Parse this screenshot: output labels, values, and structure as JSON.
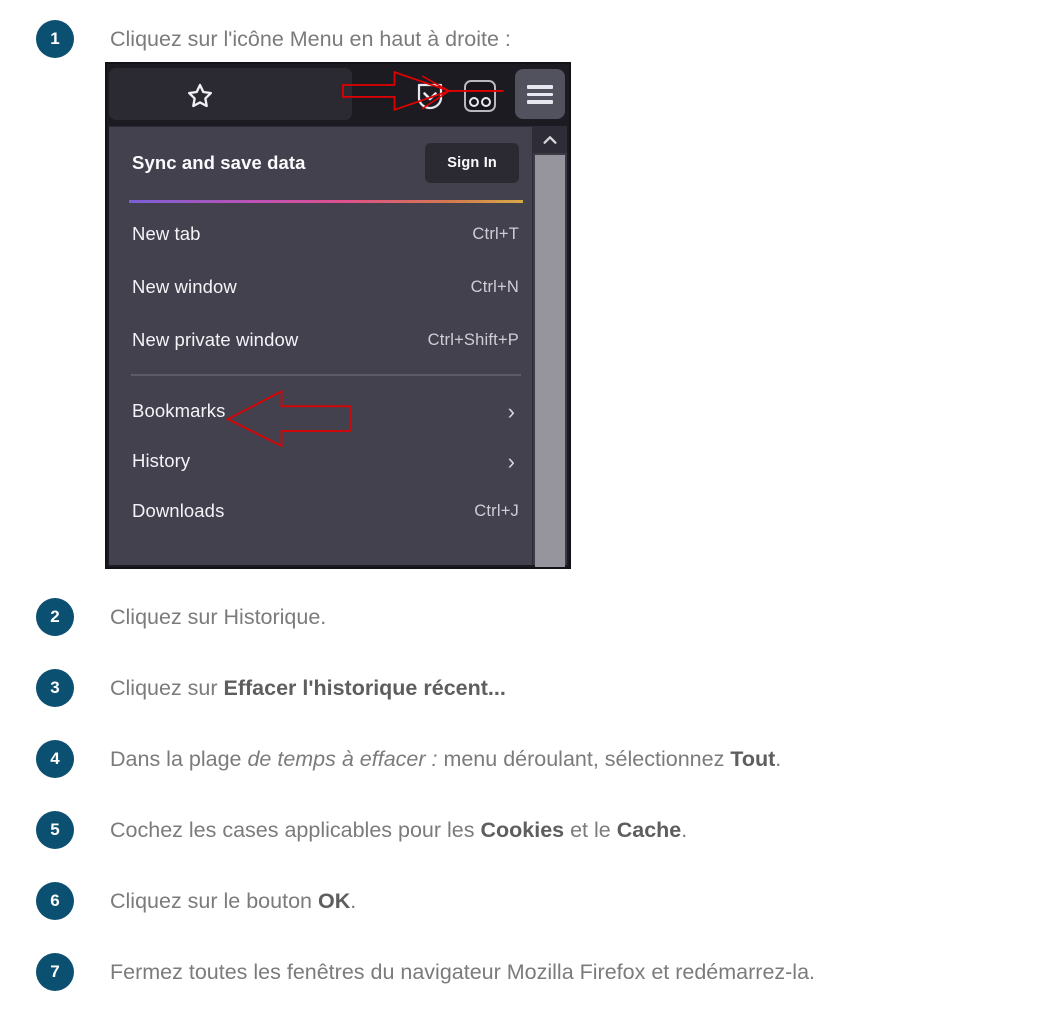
{
  "steps": [
    {
      "num": "1",
      "text_html": "Cliquez sur l'icône Menu en haut à droite :"
    },
    {
      "num": "2",
      "text_html": "Cliquez sur Historique."
    },
    {
      "num": "3",
      "text_html": "Cliquez sur <b>Effacer l'historique récent...</b>"
    },
    {
      "num": "4",
      "text_html": "Dans la plage <i>de temps à effacer :</i> menu déroulant, sélectionnez <b>Tout</b>."
    },
    {
      "num": "5",
      "text_html": "Cochez les cases applicables pour les <b>Cookies</b> et le <b>Cache</b>."
    },
    {
      "num": "6",
      "text_html": "Cliquez sur le bouton <b>OK</b>."
    },
    {
      "num": "7",
      "text_html": "Fermez toutes les fenêtres du navigateur Mozilla Firefox et redémarrez-la."
    }
  ],
  "screenshot": {
    "toolbar": {
      "bookmark_icon": "star-icon",
      "downloads_icon": "download-arrow-icon",
      "account_icon": "account-mask-icon",
      "menu_icon": "hamburger-menu-icon"
    },
    "panel": {
      "sync_label": "Sync and save data",
      "signin_label": "Sign In",
      "items": [
        {
          "label": "New tab",
          "shortcut": "Ctrl+T",
          "chevron": ""
        },
        {
          "label": "New window",
          "shortcut": "Ctrl+N",
          "chevron": ""
        },
        {
          "label": "New private window",
          "shortcut": "Ctrl+Shift+P",
          "chevron": ""
        },
        {
          "label": "Bookmarks",
          "shortcut": "",
          "chevron": "›"
        },
        {
          "label": "History",
          "shortcut": "",
          "chevron": "›"
        },
        {
          "label": "Downloads",
          "shortcut": "Ctrl+J",
          "chevron": ""
        }
      ],
      "scrollbar_up_icon": "chevron-up-icon"
    },
    "annotations": {
      "menu_arrow": "red-arrow-pointing-to-menu-icon",
      "history_arrow": "red-arrow-pointing-to-history-item"
    }
  },
  "colors": {
    "bullet": "#0b4f71",
    "step_text": "#7b7b7b",
    "annotation": "#e00000",
    "panel_bg": "#42414d",
    "toolbar_bg": "#1c1b22"
  }
}
